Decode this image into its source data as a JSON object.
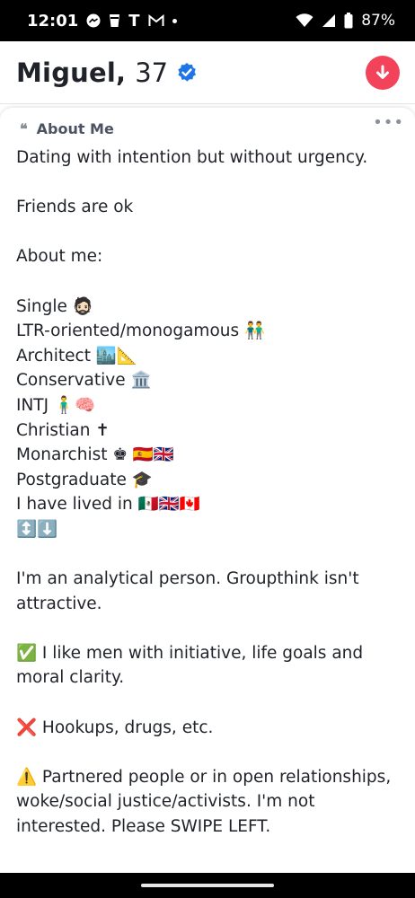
{
  "status_bar": {
    "time": "12:01",
    "t_label": "T",
    "battery": "87%",
    "icons": [
      "messenger-icon",
      "cup-icon",
      "gmail-icon",
      "wifi-icon",
      "signal-icon",
      "battery-icon"
    ]
  },
  "profile": {
    "name": "Miguel,",
    "age": "37",
    "verified_icon": "verified-badge-icon",
    "action_icon": "arrow-down-icon"
  },
  "about": {
    "title": "About Me",
    "bio": "Dating with intention but without urgency.\n\nFriends are ok\n\nAbout me:\n\nSingle 🧔🏻\nLTR-oriented/monogamous 👬\nArchitect 🏙️📐\nConservative 🏛️\nINTJ 🧍‍♂️🧠\nChristian ✝\nMonarchist ♚ 🇪🇸🇬🇧\nPostgraduate 🎓\nI have lived in 🇲🇽🇬🇧🇨🇦\n↕️⬇️\n\nI'm an analytical person. Groupthink isn't attractive.\n\n✅ I like men with initiative, life goals and moral clarity.\n\n❌ Hookups, drugs, etc.\n\n⚠️ Partnered people or in open relationships, woke/social justice/activists. I'm not interested. Please SWIPE LEFT."
  },
  "colors": {
    "accent_red": "#f2435a",
    "verified_blue": "#1d75e6",
    "text": "#1f2329",
    "muted": "#4c5360"
  }
}
